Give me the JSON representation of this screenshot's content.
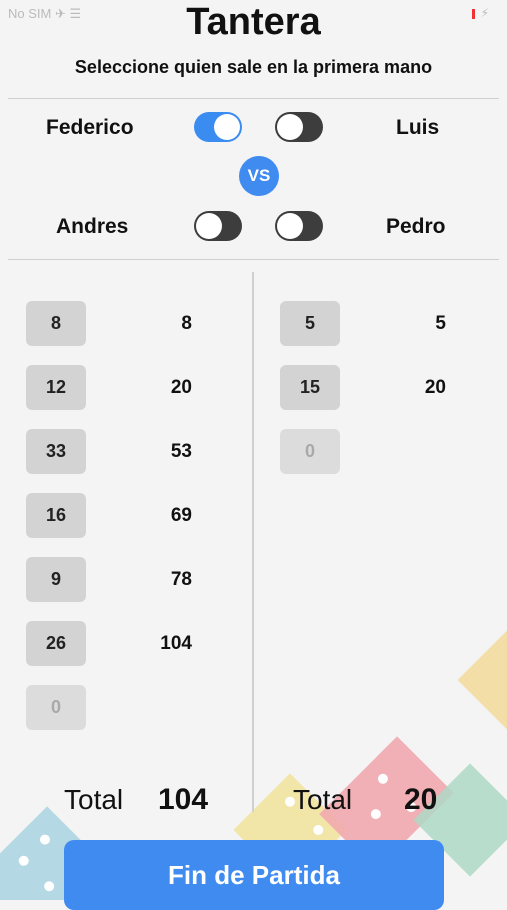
{
  "status_bar": {
    "left": "No SIM ✈ ☰",
    "right": "⚡"
  },
  "header": {
    "title": "Tantera",
    "subtitle": "Seleccione quien sale en la primera mano"
  },
  "players": {
    "row1": {
      "left_name": "Federico",
      "left_on": true,
      "right_name": "Luis",
      "right_on": false
    },
    "vs_label": "VS",
    "row2": {
      "left_name": "Andres",
      "left_on": false,
      "right_name": "Pedro",
      "right_on": false
    }
  },
  "team_left": {
    "scores": [
      "8",
      "12",
      "33",
      "16",
      "9",
      "26"
    ],
    "cumulative": [
      "8",
      "20",
      "53",
      "69",
      "78",
      "104"
    ],
    "next_placeholder": "0",
    "total_label": "Total",
    "total_value": "104"
  },
  "team_right": {
    "scores": [
      "5",
      "15"
    ],
    "cumulative": [
      "5",
      "20"
    ],
    "next_placeholder": "0",
    "total_label": "Total",
    "total_value": "20"
  },
  "footer": {
    "fin_label": "Fin de Partida"
  },
  "colors": {
    "accent": "#3f8bf0",
    "toggle_off": "#3d3d3d",
    "score_bg": "#d3d3d3",
    "background": "#f4f4f4"
  }
}
